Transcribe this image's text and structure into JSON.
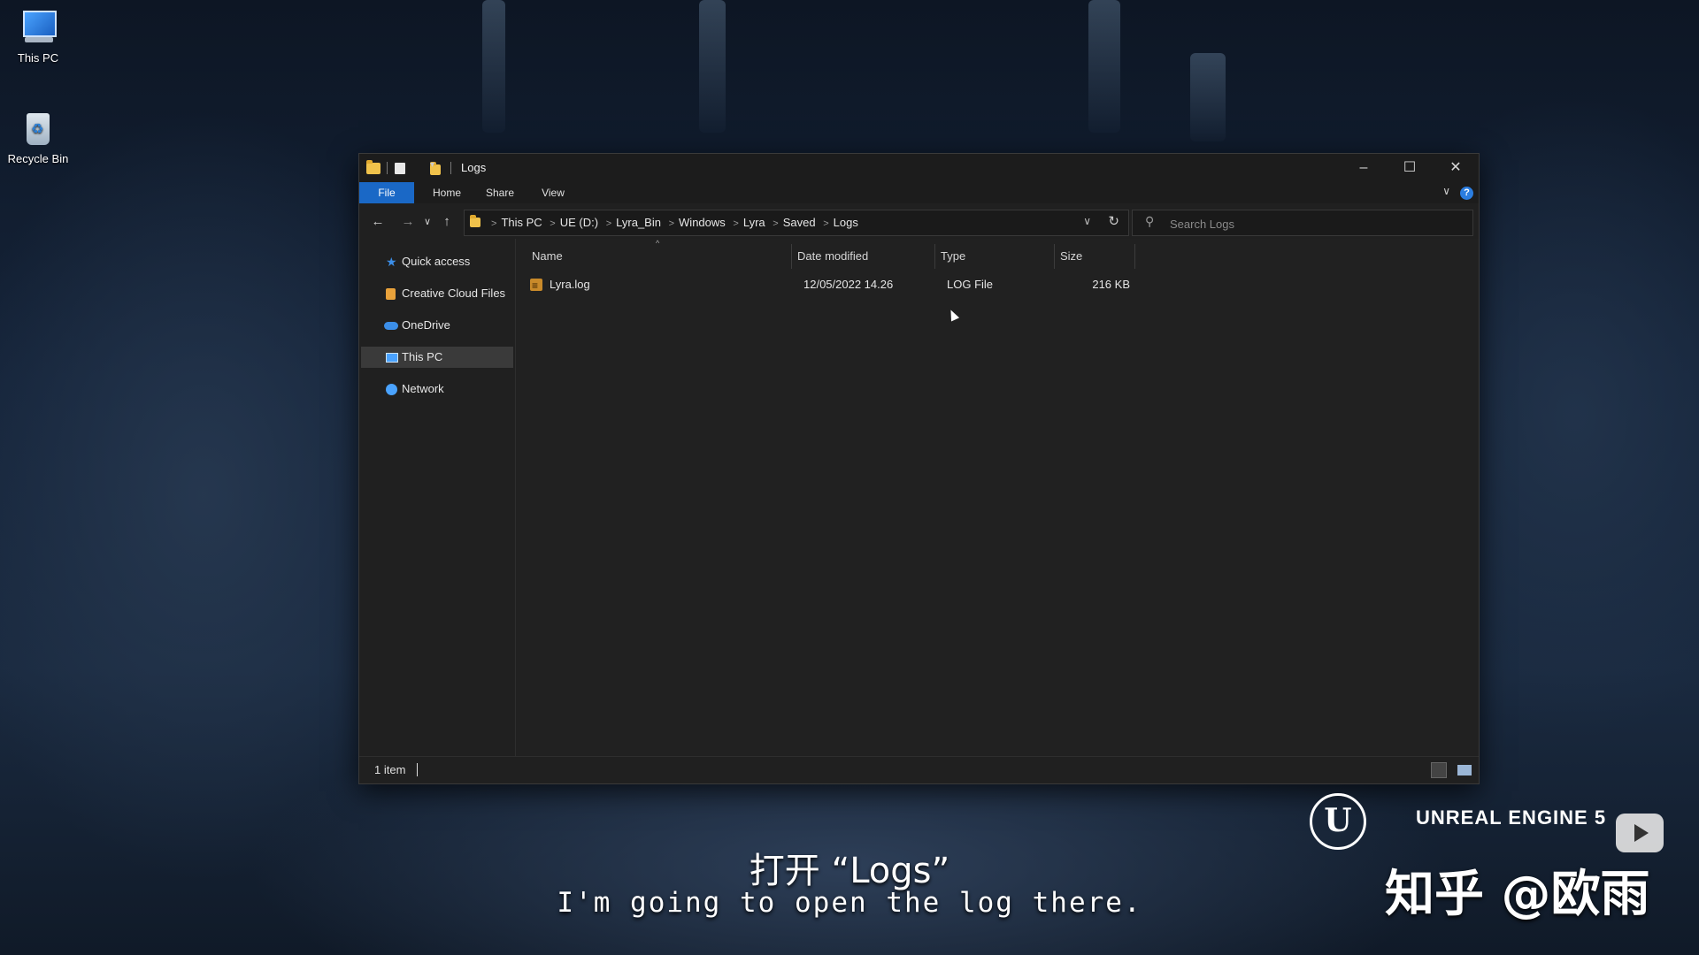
{
  "desktop": {
    "icons": [
      {
        "label": "This PC"
      },
      {
        "label": "Recycle Bin"
      }
    ]
  },
  "window": {
    "title": "Logs",
    "ribbon_tabs": [
      "File",
      "Home",
      "Share",
      "View"
    ],
    "breadcrumb": [
      "This PC",
      "UE (D:)",
      "Lyra_Bin",
      "Windows",
      "Lyra",
      "Saved",
      "Logs"
    ],
    "search_placeholder": "Search Logs",
    "nav_items": [
      {
        "label": "Quick access",
        "icon": "star-icon"
      },
      {
        "label": "Creative Cloud Files",
        "icon": "creative-cloud-icon"
      },
      {
        "label": "OneDrive",
        "icon": "cloud-icon"
      },
      {
        "label": "This PC",
        "icon": "computer-icon",
        "selected": true
      },
      {
        "label": "Network",
        "icon": "network-icon"
      }
    ],
    "columns": [
      "Name",
      "Date modified",
      "Type",
      "Size"
    ],
    "files": [
      {
        "name": "Lyra.log",
        "date_modified": "12/05/2022 14.26",
        "type": "LOG File",
        "size": "216 KB"
      }
    ],
    "status": "1 item"
  },
  "overlay": {
    "subtitle_cn": "打开 “Logs”",
    "subtitle_en": "I'm going to open the log there.",
    "logo_text": "UNREAL ENGINE 5",
    "logo_glyph": "U",
    "watermark": "知乎 @欧雨"
  },
  "colors": {
    "accent": "#1a68c6",
    "window_bg": "#202020"
  }
}
